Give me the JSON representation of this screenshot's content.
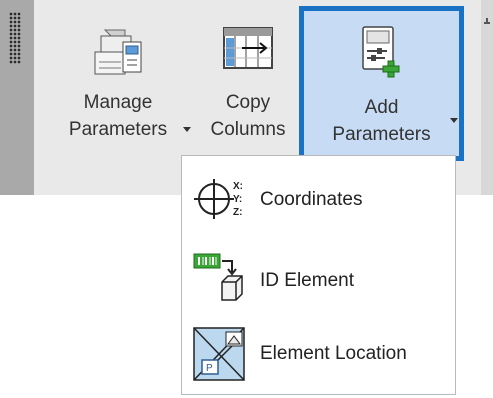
{
  "ribbon": {
    "buttons": [
      {
        "line1": "Manage",
        "line2": "Parameters",
        "icon": "manage-parameters-icon",
        "has_dropdown": true
      },
      {
        "line1": "Copy",
        "line2": "Columns",
        "icon": "copy-columns-icon",
        "has_dropdown": false
      },
      {
        "line1": "Add",
        "line2": "Parameters",
        "icon": "add-parameters-icon",
        "has_dropdown": true,
        "active": true
      }
    ]
  },
  "menu": {
    "items": [
      {
        "label": "Coordinates",
        "icon": "coordinates-icon",
        "icon_text": [
          "X:",
          "Y:",
          "Z:"
        ]
      },
      {
        "label": "ID Element",
        "icon": "id-element-icon"
      },
      {
        "label": "Element Location",
        "icon": "element-location-icon"
      }
    ]
  },
  "colors": {
    "active_border": "#1a72c4",
    "active_fill": "#c7dcf4",
    "accent_green": "#3aa635"
  }
}
